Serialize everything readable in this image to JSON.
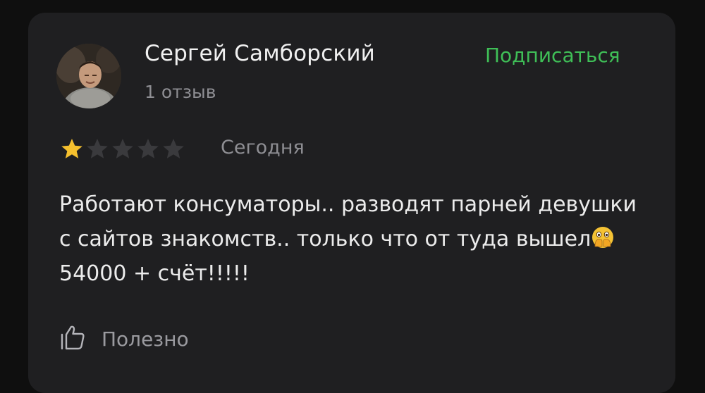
{
  "review": {
    "author_name": "Сергей Самборский",
    "reviews_count": "1 отзыв",
    "subscribe_label": "Подписаться",
    "rating": 1,
    "rating_max": 5,
    "date": "Сегодня",
    "text_part1": "Работают консуматоры.. разводят парней девушки с сайтов знакомств.. только что от туда вышел",
    "text_emoji": "face-with-open-eyes-and-hand-over-mouth",
    "text_part2": "54000 + счёт!!!!!",
    "useful_label": "Полезно"
  },
  "colors": {
    "card_bg": "#1f1f21",
    "accent_green": "#3fbf57",
    "star_active": "#f5c02e",
    "star_inactive": "#3a3a3d",
    "muted_text": "#8e8e93"
  },
  "icons": {
    "avatar": "user-photo",
    "star": "star-icon",
    "useful": "thumbs-up-icon"
  }
}
